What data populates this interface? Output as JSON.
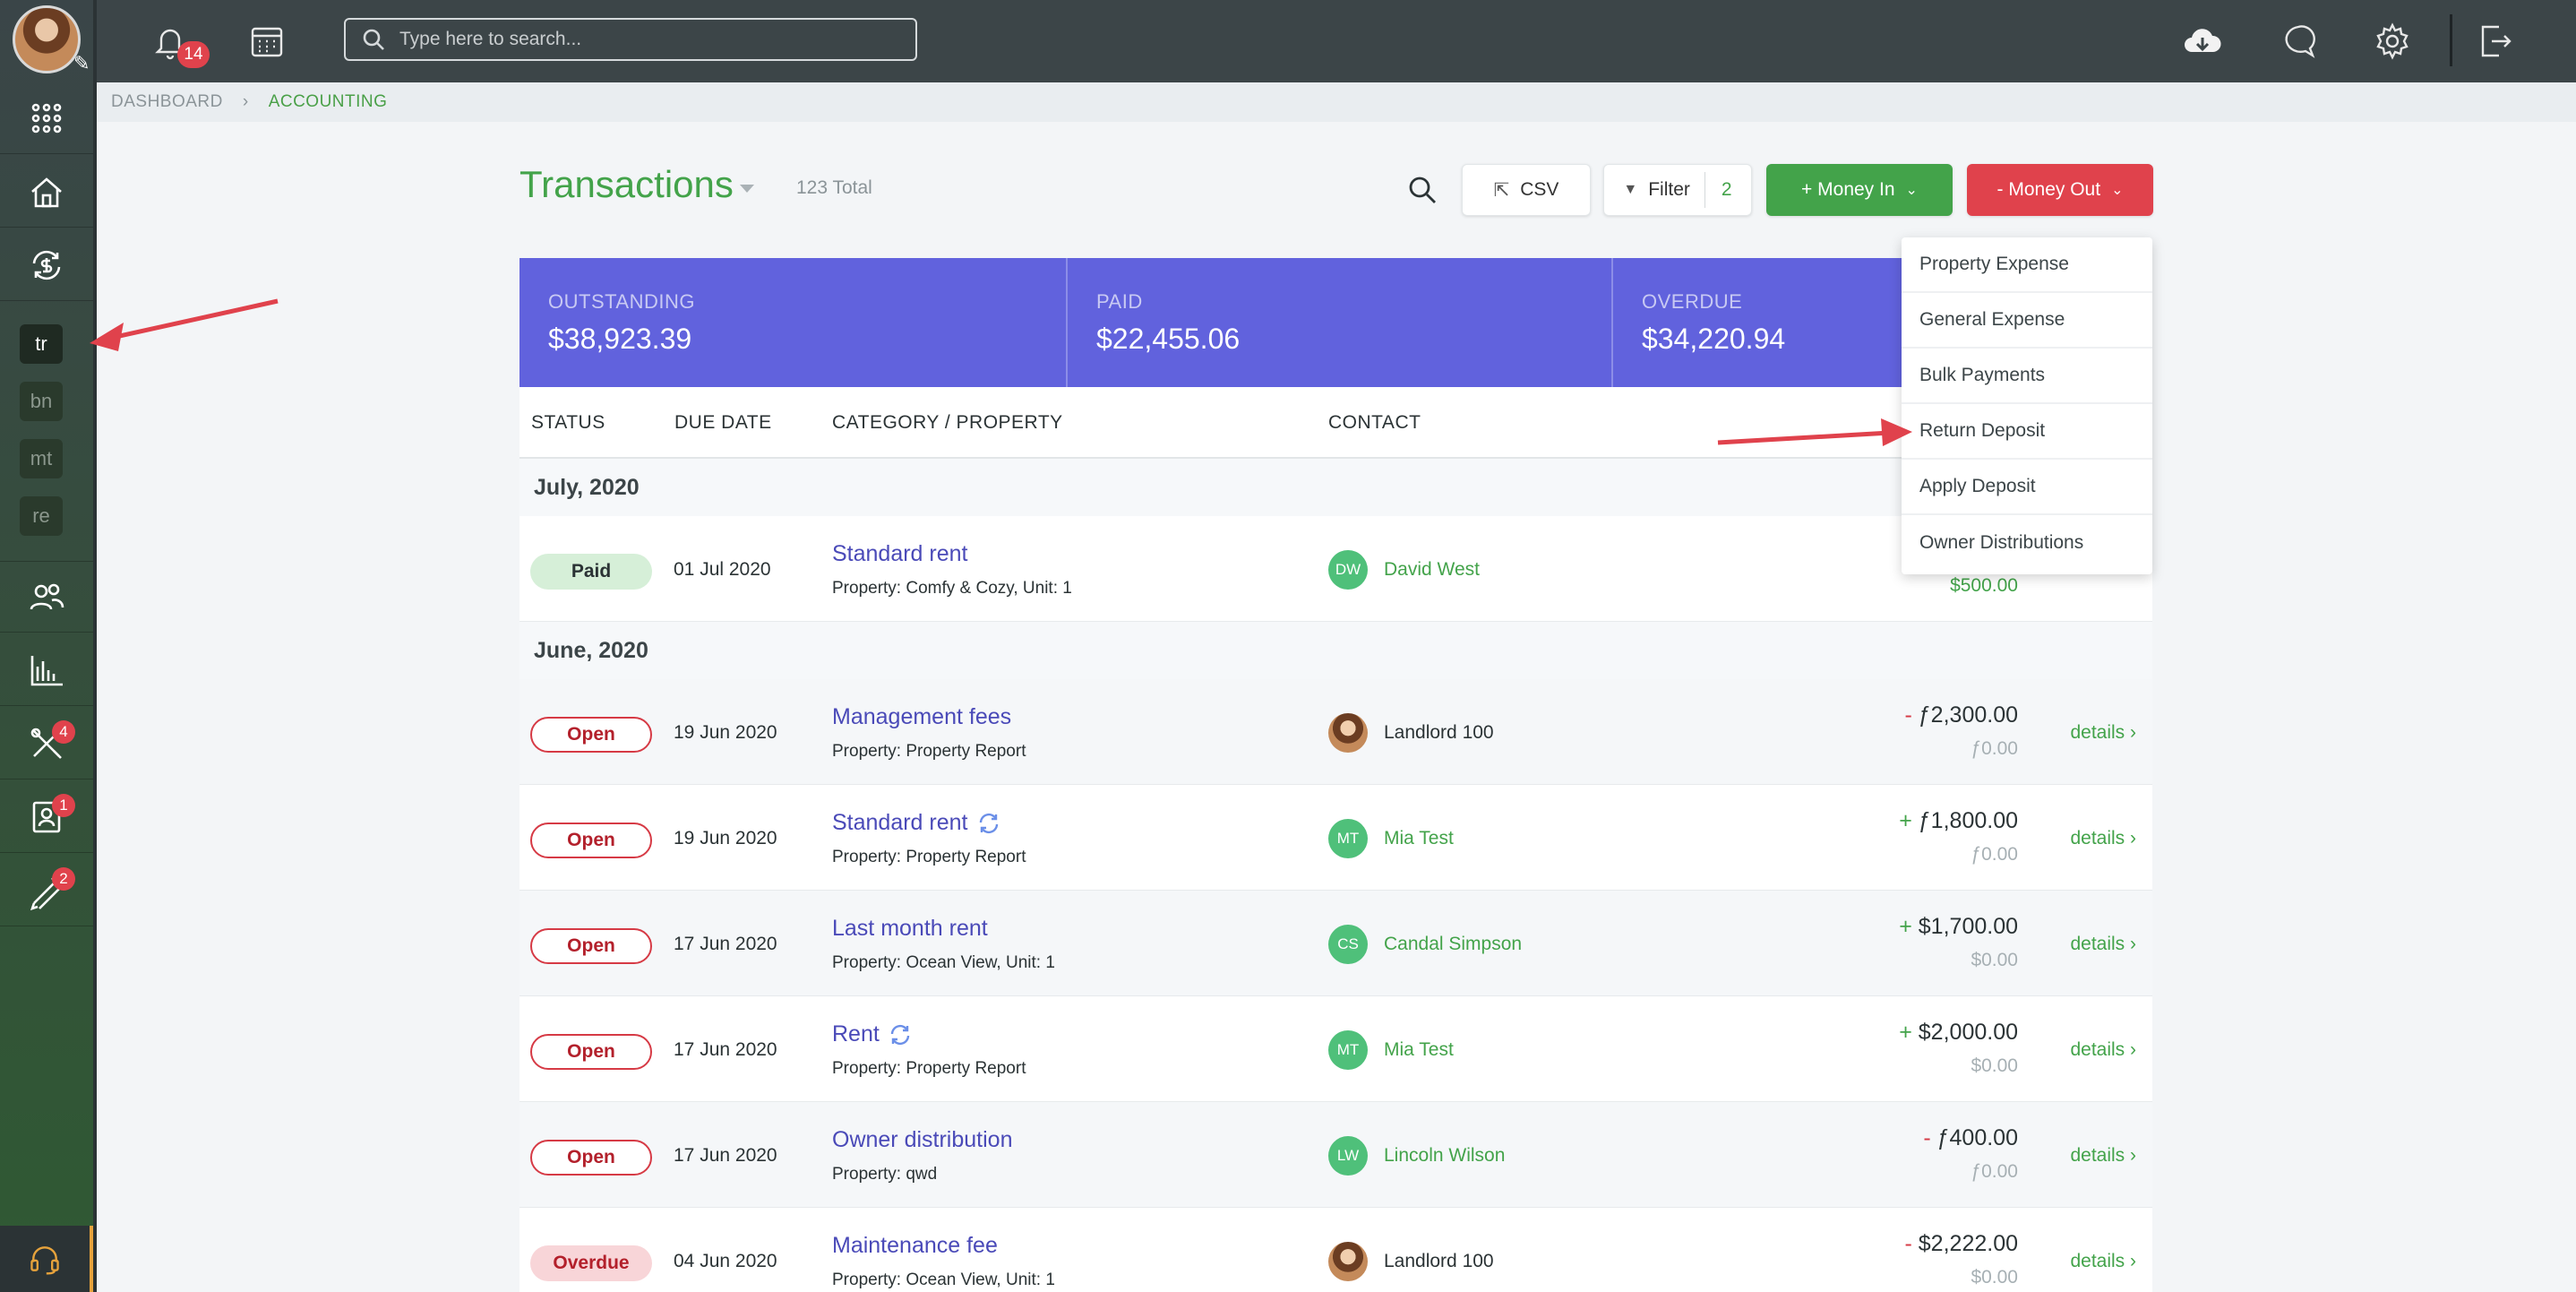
{
  "topbar": {
    "search_placeholder": "Type here to search...",
    "notifications_count": "14"
  },
  "sidebar": {
    "tags": [
      "tr",
      "bn",
      "mt",
      "re"
    ],
    "badges": {
      "maintenance": "4",
      "tenants": "1",
      "tools": "2"
    }
  },
  "breadcrumb": {
    "items": [
      "DASHBOARD",
      "ACCOUNTING"
    ]
  },
  "header": {
    "title": "Transactions",
    "total": "123 Total",
    "csv_label": "CSV",
    "filter_label": "Filter",
    "filter_count": "2",
    "money_in_label": "+ Money In",
    "money_out_label": "- Money Out"
  },
  "summary": [
    {
      "label": "OUTSTANDING",
      "value": "$38,923.39"
    },
    {
      "label": "PAID",
      "value": "$22,455.06"
    },
    {
      "label": "OVERDUE",
      "value": "$34,220.94"
    }
  ],
  "table": {
    "columns": [
      "STATUS",
      "DUE DATE",
      "CATEGORY / PROPERTY",
      "CONTACT"
    ],
    "groups": [
      "July, 2020",
      "June, 2020"
    ],
    "rows": [
      {
        "status": "Paid",
        "due": "01 Jul 2020",
        "category": "Standard rent",
        "property": "Property: Comfy & Cozy, Unit: 1",
        "initials": "DW",
        "contact": "David West",
        "sign": "",
        "amount": "",
        "sub": "$500.00",
        "details": ""
      },
      {
        "status": "Open",
        "due": "19 Jun 2020",
        "category": "Management fees",
        "property": "Property: Property Report",
        "initials": "",
        "contact": "Landlord 100",
        "sign": "-",
        "amount": "ƒ2,300.00",
        "sub": "ƒ0.00",
        "details": "details ›"
      },
      {
        "status": "Open",
        "due": "19 Jun 2020",
        "category": "Standard rent",
        "property": "Property: Property Report",
        "initials": "MT",
        "contact": "Mia Test",
        "sign": "+",
        "amount": "ƒ1,800.00",
        "sub": "ƒ0.00",
        "details": "details ›"
      },
      {
        "status": "Open",
        "due": "17 Jun 2020",
        "category": "Last month rent",
        "property": "Property: Ocean View, Unit: 1",
        "initials": "CS",
        "contact": "Candal Simpson",
        "sign": "+",
        "amount": "$1,700.00",
        "sub": "$0.00",
        "details": "details ›"
      },
      {
        "status": "Open",
        "due": "17 Jun 2020",
        "category": "Rent",
        "property": "Property: Property Report",
        "initials": "MT",
        "contact": "Mia Test",
        "sign": "+",
        "amount": "$2,000.00",
        "sub": "$0.00",
        "details": "details ›"
      },
      {
        "status": "Open",
        "due": "17 Jun 2020",
        "category": "Owner distribution",
        "property": "Property: qwd",
        "initials": "LW",
        "contact": "Lincoln Wilson",
        "sign": "-",
        "amount": "ƒ400.00",
        "sub": "ƒ0.00",
        "details": "details ›"
      },
      {
        "status": "Overdue",
        "due": "04 Jun 2020",
        "category": "Maintenance fee",
        "property": "Property: Ocean View, Unit: 1",
        "initials": "",
        "contact": "Landlord 100",
        "sign": "-",
        "amount": "$2,222.00",
        "sub": "$0.00",
        "details": "details ›"
      }
    ]
  },
  "money_out_menu": {
    "items": [
      "Property Expense",
      "General Expense",
      "Bulk Payments",
      "Return Deposit",
      "Apply Deposit",
      "Owner Distributions"
    ]
  },
  "colors": {
    "accent_green": "#43a34a",
    "danger_red": "#e0424c",
    "summary_purple": "#6162dd",
    "sidebar_dark": "#3c4548"
  }
}
